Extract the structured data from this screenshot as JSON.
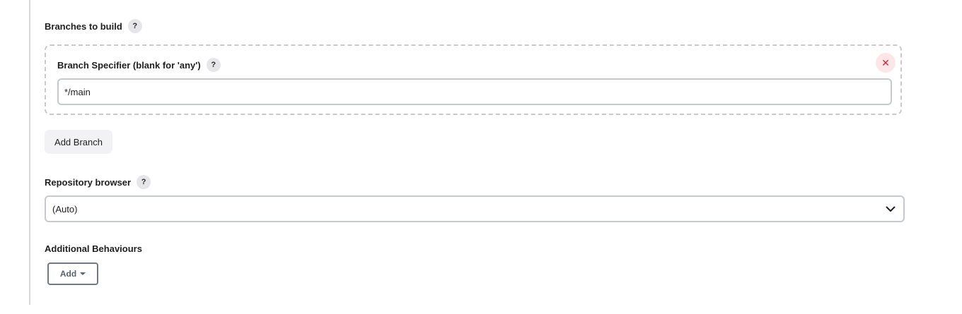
{
  "branches_section": {
    "label": "Branches to build",
    "help_icon": "question-mark-icon",
    "help_text": "?"
  },
  "branch_specifier": {
    "label": "Branch Specifier (blank for 'any')",
    "help_text": "?",
    "value": "*/main",
    "delete_icon": "close-icon",
    "delete_glyph": "✕"
  },
  "add_branch_button": {
    "label": "Add Branch"
  },
  "repository_browser": {
    "label": "Repository browser",
    "help_text": "?",
    "selected_value": "(Auto)",
    "dropdown_icon": "chevron-down-icon"
  },
  "additional_behaviours": {
    "label": "Additional Behaviours",
    "add_button_label": "Add",
    "add_button_icon": "caret-down-icon"
  },
  "colors": {
    "accent_delete": "#d1243a",
    "delete_bg": "#fde6e8",
    "border": "#c6c9cd"
  }
}
